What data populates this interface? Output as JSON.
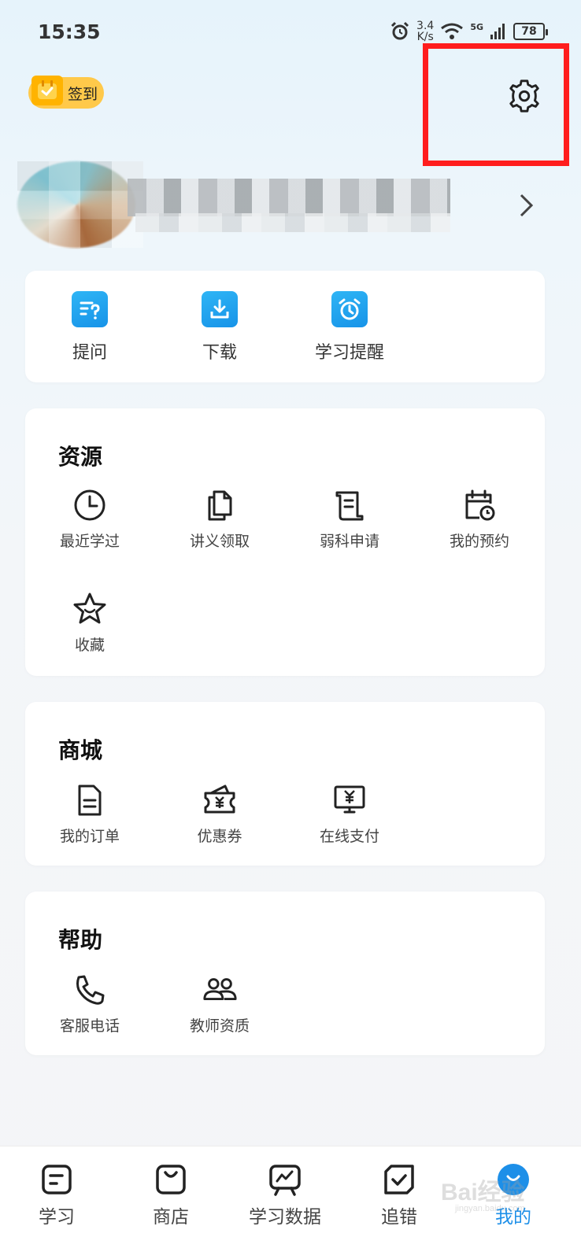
{
  "status_bar": {
    "time": "15:35",
    "net_speed_value": "3.4",
    "net_speed_unit": "K/s",
    "network_type": "5G",
    "battery": "78"
  },
  "header": {
    "checkin_label": "签到",
    "settings_icon": "gear-icon"
  },
  "quick_actions": [
    {
      "label": "提问",
      "icon": "question-icon"
    },
    {
      "label": "下载",
      "icon": "download-icon"
    },
    {
      "label": "学习提醒",
      "icon": "alarm-icon"
    }
  ],
  "resources": {
    "title": "资源",
    "items": [
      {
        "label": "最近学过",
        "icon": "clock-icon"
      },
      {
        "label": "讲义领取",
        "icon": "documents-icon"
      },
      {
        "label": "弱科申请",
        "icon": "scroll-icon"
      },
      {
        "label": "我的预约",
        "icon": "calendar-clock-icon"
      },
      {
        "label": "收藏",
        "icon": "star-icon"
      }
    ]
  },
  "mall": {
    "title": "商城",
    "items": [
      {
        "label": "我的订单",
        "icon": "order-icon"
      },
      {
        "label": "优惠券",
        "icon": "coupon-icon"
      },
      {
        "label": "在线支付",
        "icon": "payment-icon"
      }
    ]
  },
  "help": {
    "title": "帮助",
    "items": [
      {
        "label": "客服电话",
        "icon": "phone-icon"
      },
      {
        "label": "教师资质",
        "icon": "teachers-icon"
      }
    ]
  },
  "bottom_nav": [
    {
      "label": "学习",
      "icon": "study-icon"
    },
    {
      "label": "商店",
      "icon": "shop-icon"
    },
    {
      "label": "学习数据",
      "icon": "chart-board-icon"
    },
    {
      "label": "追错",
      "icon": "check-note-icon"
    },
    {
      "label": "我的",
      "icon": "profile-icon",
      "active": true
    }
  ],
  "colors": {
    "accent": "#1d8fe8",
    "highlight": "#ff1d1d",
    "checkin": "#ffc94a"
  },
  "watermark": {
    "main": "Bai经验",
    "sub": "jingyan.baidu.com"
  }
}
